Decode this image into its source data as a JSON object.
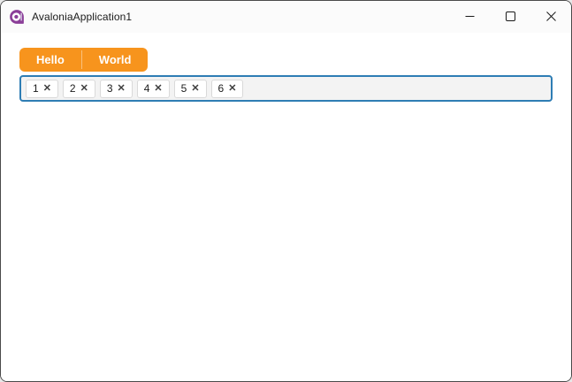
{
  "window": {
    "title": "AvaloniaApplication1",
    "border_color": "#4a4a4a"
  },
  "titlebar": {
    "logo_color": "#8b3e98",
    "controls": {
      "minimize": "minimize",
      "maximize": "maximize",
      "close": "close"
    }
  },
  "toolbar": {
    "accent_color": "#f7941d",
    "buttons": [
      {
        "label": "Hello"
      },
      {
        "label": "World"
      }
    ]
  },
  "tags_input": {
    "border_color": "#2e7db4",
    "background": "#f3f3f3",
    "remove_glyph": "✕",
    "items": [
      {
        "value": "1"
      },
      {
        "value": "2"
      },
      {
        "value": "3"
      },
      {
        "value": "4"
      },
      {
        "value": "5"
      },
      {
        "value": "6"
      }
    ]
  }
}
